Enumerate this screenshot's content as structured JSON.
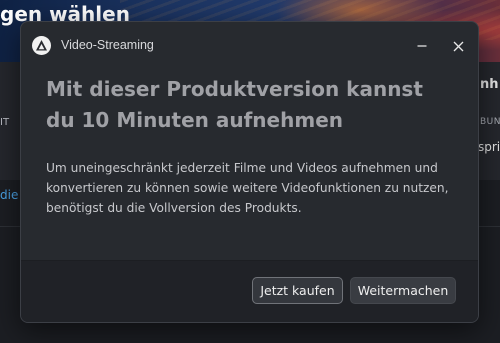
{
  "background": {
    "page_title_partial": "gen wählen",
    "left_label_partial": "IT",
    "left_link_partial": "die",
    "right_heading_partial": "nh",
    "right_label_partial": "BUN",
    "right_text_partial": "spri"
  },
  "dialog": {
    "window_title": "Video-Streaming",
    "app_icon": "app-logo-icon",
    "minimize_icon": "minimize-icon",
    "close_icon": "close-icon",
    "headline": "Mit dieser Produktversion kannst du 10 Minuten aufnehmen",
    "body": "Um uneingeschränkt jederzeit Filme und Videos aufnehmen und konvertieren zu können sowie weitere Videofunktionen zu nutzen, benötigst du die Vollversion des Produkts.",
    "buttons": {
      "buy": "Jetzt kaufen",
      "continue": "Weitermachen"
    }
  },
  "colors": {
    "dialog_bg": "#272a2f",
    "footer_bg": "#202227",
    "headline": "#a0a1a6",
    "link": "#4aa3e6"
  }
}
